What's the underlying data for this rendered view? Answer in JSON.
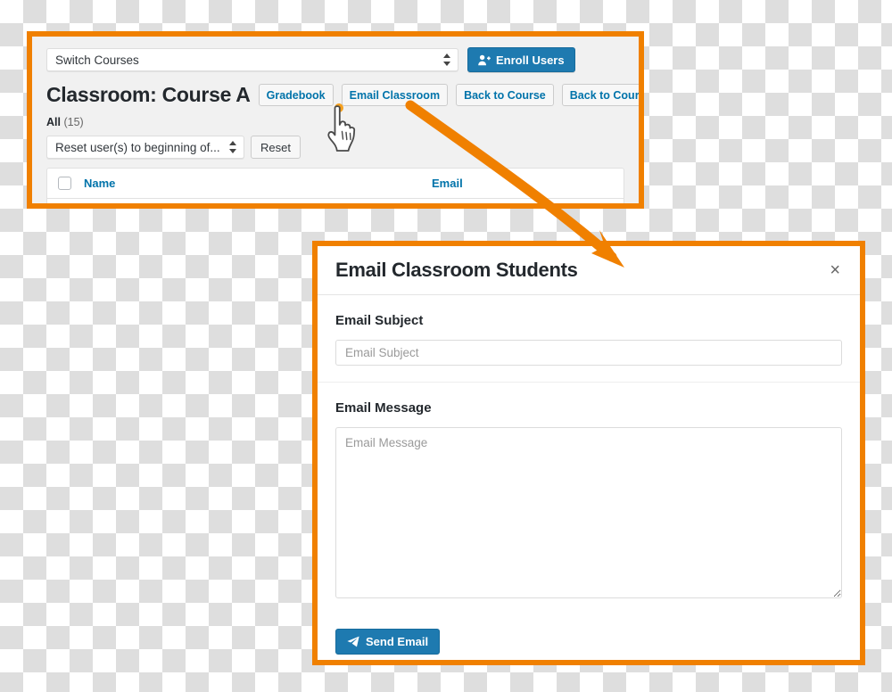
{
  "admin_panel": {
    "switch_courses_select": {
      "value": "Switch Courses",
      "icon": "select-updown-icon"
    },
    "enroll_users_button": {
      "label": "Enroll Users",
      "icon": "user-plus-icon"
    },
    "page_title": "Classroom: Course A",
    "action_buttons": [
      {
        "label": "Gradebook"
      },
      {
        "label": "Email Classroom"
      },
      {
        "label": "Back to Course"
      },
      {
        "label": "Back to Courses"
      }
    ],
    "subsubsub": {
      "all_label": "All",
      "count": "(15)"
    },
    "bulk_action_select": {
      "value": "Reset user(s) to beginning of...",
      "icon": "select-updown-icon"
    },
    "reset_button": {
      "label": "Reset"
    },
    "table": {
      "columns": [
        "Name",
        "Email"
      ]
    }
  },
  "modal": {
    "title": "Email Classroom Students",
    "close_icon": "×",
    "subject": {
      "label": "Email Subject",
      "value": "",
      "placeholder": "Email Subject"
    },
    "message": {
      "label": "Email Message",
      "value": "",
      "placeholder": "Email Message"
    },
    "send_button": {
      "label": "Send Email",
      "icon": "paper-plane-icon"
    }
  },
  "annotations": {
    "highlight_color": "#f08000",
    "arrow_name": "callout-arrow",
    "cursor_name": "hand-cursor"
  },
  "colors": {
    "accent_blue": "#1e7ab0",
    "link_blue": "#0073aa",
    "highlight_orange": "#f08000",
    "checker_gray": "#dedede"
  }
}
